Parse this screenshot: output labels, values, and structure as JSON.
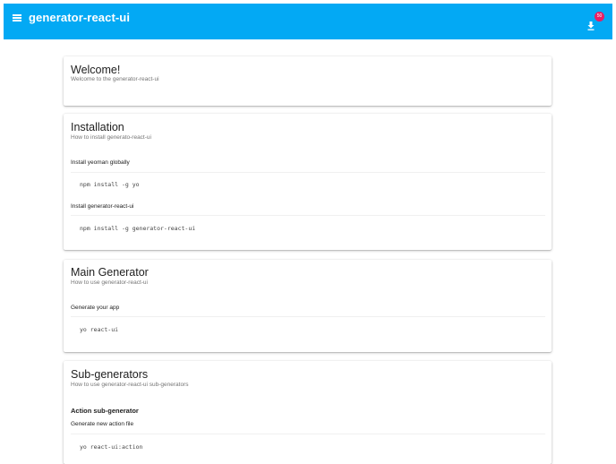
{
  "header": {
    "title": "generator-react-ui",
    "badge_count": "50",
    "menu_icon": "menu-icon",
    "download_icon": "download-icon",
    "color": "#03a9f4",
    "badge_color": "#e91e63"
  },
  "cards": {
    "welcome": {
      "title": "Welcome!",
      "subtitle": "Welcome to the generator-react-ui"
    },
    "installation": {
      "title": "Installation",
      "subtitle": "How to install generato-react-ui",
      "step1_label": "Install yeoman globally",
      "step1_code": "npm install -g yo",
      "step2_label": "Install generator-react-ui",
      "step2_code": "npm install -g generator-react-ui"
    },
    "main_generator": {
      "title": "Main Generator",
      "subtitle": "How to use generator-react-ui",
      "step1_label": "Generate your app",
      "step1_code": "yo react-ui"
    },
    "sub_generators": {
      "title": "Sub-generators",
      "subtitle": "How to use generator-react-ui sub-generators",
      "section_title": "Action sub-generator",
      "step1_label": "Generate new action file",
      "step1_code": "yo react-ui:action"
    }
  }
}
